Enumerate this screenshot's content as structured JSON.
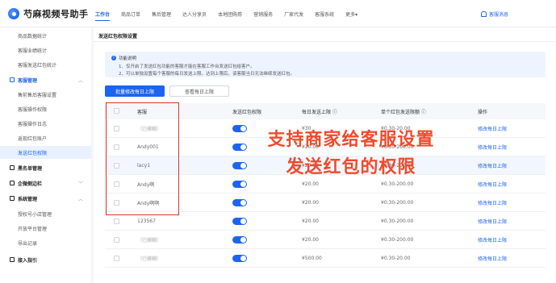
{
  "app": {
    "title": "芍麻视频号助手"
  },
  "nav": {
    "items": [
      "工作台",
      "商品订单",
      "售后管理",
      "达人分享员",
      "本地团购券",
      "营销服务",
      "厂家代发",
      "客服系统",
      "更多▾"
    ],
    "notice": "客服消息"
  },
  "sidebar": {
    "items_top": [
      "商品数据统计",
      "客服业绩统计",
      "客服发送红包统计"
    ],
    "group_kefu": "客服管理",
    "items_kefu": [
      "售前售后客服设置",
      "客服操作权限",
      "客服操作日志",
      "返现红包账户",
      "发送红包权限"
    ],
    "group_blacklist": "黑名单管理",
    "group_enterprise": "企微侧边栏",
    "group_system": "系统管理",
    "items_system": [
      "授权号小店管理",
      "开放平台管理",
      "导出记录"
    ],
    "group_guide": "接入指引"
  },
  "main": {
    "title": "发送红包权限设置",
    "tip": {
      "heading": "功能说明",
      "line1": "1、仅开启了发送红包功能的客服才能在客服工作台发送红包给客户。",
      "line2": "2、可以单独设置每个客服的每日发送上限。达到上限后，该客服当日无法继续发送红包。"
    },
    "btn_batch": "批量修改每日上限",
    "btn_view": "查看每日上限"
  },
  "table": {
    "headers": [
      "客服",
      "发送红包权限",
      "每日发送上限 ⓘ",
      "单个红包发送限额 ⓘ",
      "操作"
    ],
    "rows": [
      {
        "name": "（已模糊）",
        "daily": "¥30",
        "range": "¥0.30-20.00",
        "op": "修改每日上限",
        "blur": true
      },
      {
        "name": "Andy001",
        "daily": "¥20.00",
        "range": "¥0.30-200.00",
        "op": "修改每日上限",
        "blur": false
      },
      {
        "name": "lacy1",
        "daily": "¥20.00",
        "range": "¥0.30-200.00",
        "op": "修改每日上限",
        "blur": false
      },
      {
        "name": "Andy啊",
        "daily": "¥20.00",
        "range": "¥0.30-200.00",
        "op": "修改每日上限",
        "blur": false
      },
      {
        "name": "Andy啊啊",
        "daily": "¥20.00",
        "range": "¥0.30-200.00",
        "op": "修改每日上限",
        "blur": false
      },
      {
        "name": "123567",
        "daily": "¥20.00",
        "range": "¥0.30-200.00",
        "op": "修改每日上限",
        "blur": false
      },
      {
        "name": "（已模糊）",
        "daily": "¥20.00",
        "range": "¥0.30-200.00",
        "op": "修改每日上限",
        "blur": true
      },
      {
        "name": "（已模糊）",
        "daily": "¥500.00",
        "range": "¥0.30-20.00",
        "op": "修改每日上限",
        "blur": true
      }
    ]
  },
  "overlay": {
    "line1": "支持商家给客服设置",
    "line2": "发送红包的权限",
    "color": "#f24a2c"
  },
  "colors": {
    "accent": "#1c64f2",
    "annotation_red": "#e0322a"
  }
}
